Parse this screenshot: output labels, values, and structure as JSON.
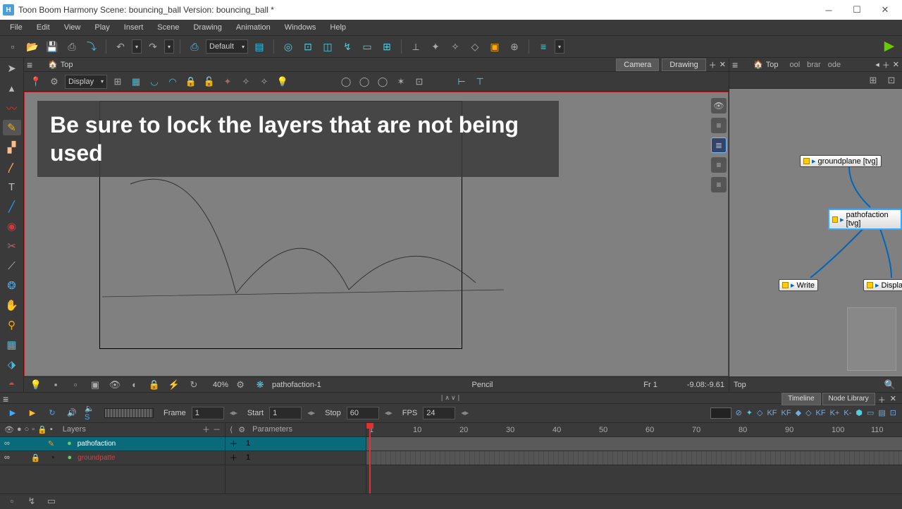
{
  "titlebar": {
    "app_letter": "H",
    "title": "Toon Boom Harmony Scene: bouncing_ball Version: bouncing_ball *"
  },
  "menu": [
    "File",
    "Edit",
    "View",
    "Play",
    "Insert",
    "Scene",
    "Drawing",
    "Animation",
    "Windows",
    "Help"
  ],
  "toolbar": {
    "display_mode": "Default"
  },
  "camera_panel": {
    "tab": "Top",
    "mode_tabs": [
      "Camera",
      "Drawing"
    ],
    "display_dropdown": "Display",
    "overlay": "Be sure to lock the layers that are not being used",
    "zoom": "40%",
    "layer_label": "pathofaction-1",
    "tool_label": "Pencil",
    "frame_label": "Fr 1",
    "coords": "-9.08:-9.61"
  },
  "node_panel": {
    "tab": "Top",
    "short_tabs": [
      "ool",
      "brar",
      "ode"
    ],
    "nodes": {
      "groundplane": "groundplane  [tvg]",
      "pathofaction": "pathofaction  [tvg]",
      "write": "Write",
      "display": "Display"
    },
    "footer": "Top"
  },
  "timeline": {
    "tabs": [
      "Timeline",
      "Node Library"
    ],
    "frame_label": "Frame",
    "frame": "1",
    "start_label": "Start",
    "start": "1",
    "stop_label": "Stop",
    "stop": "60",
    "fps_label": "FPS",
    "fps": "24",
    "layers_header": "Layers",
    "params_header": "Parameters",
    "layers": [
      {
        "name": "pathofaction",
        "frame": "1",
        "selected": true
      },
      {
        "name": "groundpatte",
        "frame": "1",
        "locked": true
      }
    ],
    "ruler_ticks": [
      "1",
      "10",
      "20",
      "30",
      "40",
      "50",
      "60",
      "70",
      "80",
      "90",
      "100",
      "110"
    ],
    "kf_labels": [
      "KF",
      "KF",
      "KF",
      "K+",
      "K-"
    ]
  }
}
